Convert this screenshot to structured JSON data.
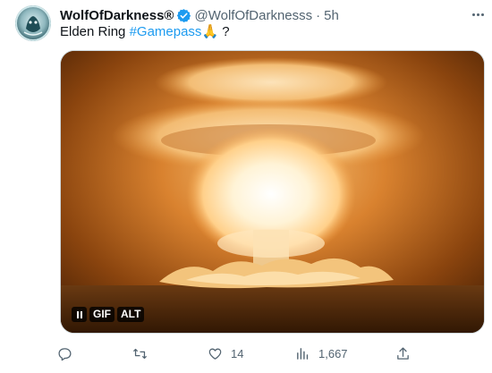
{
  "author": {
    "display_name": "WolfOfDarkness®",
    "handle": "@WolfOfDarknesss",
    "separator": "·",
    "time": "5h"
  },
  "tweet": {
    "text_prefix": "Elden Ring ",
    "hashtag": "#Gamepass",
    "emoji": "🙏",
    "text_suffix": " ?"
  },
  "media": {
    "type": "gif",
    "gif_label": "GIF",
    "alt_label": "ALT"
  },
  "actions": {
    "reply_count": "",
    "retweet_count": "",
    "like_count": "14",
    "views_count": "1,667"
  },
  "icons": {
    "verified": "verified-badge-icon",
    "more": "more-icon",
    "reply": "reply-icon",
    "retweet": "retweet-icon",
    "like": "heart-icon",
    "views": "views-icon",
    "share": "share-icon",
    "pause": "pause-icon"
  },
  "colors": {
    "accent": "#1d9bf0",
    "muted_text": "#536471",
    "text": "#0f1419"
  }
}
